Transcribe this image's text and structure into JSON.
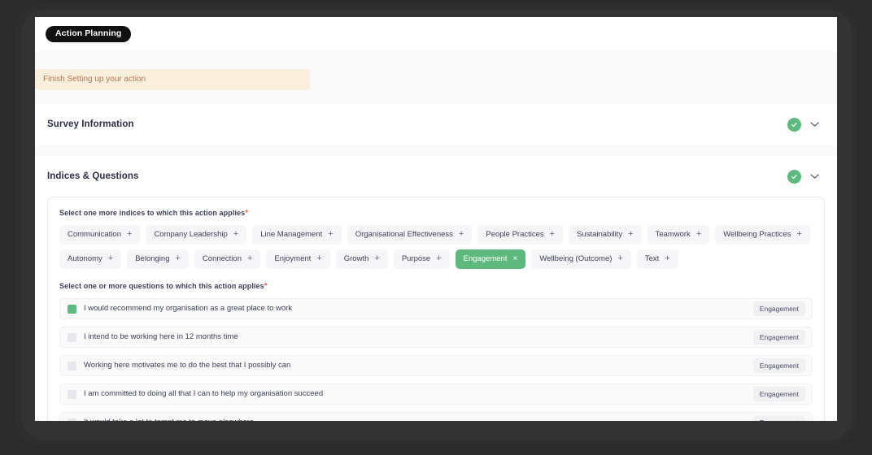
{
  "breadcrumb": {
    "label": "Action Planning"
  },
  "notice": {
    "text": "Finish Setting up your action"
  },
  "sections": [
    {
      "title": "Survey Information",
      "status_icon": "check-circle-icon",
      "toggle_icon": "chevron-down-icon"
    },
    {
      "title": "Indices & Questions",
      "status_icon": "check-circle-icon",
      "toggle_icon": "chevron-down-icon"
    }
  ],
  "indices": {
    "label": "Select one more indices to which this action applies",
    "required_marker": "*",
    "add_symbol": "+",
    "remove_symbol": "×",
    "chips": [
      {
        "label": "Communication",
        "selected": false
      },
      {
        "label": "Company Leadership",
        "selected": false
      },
      {
        "label": "Line Management",
        "selected": false
      },
      {
        "label": "Organisational Effectiveness",
        "selected": false
      },
      {
        "label": "People Practices",
        "selected": false
      },
      {
        "label": "Sustainability",
        "selected": false
      },
      {
        "label": "Teamwork",
        "selected": false
      },
      {
        "label": "Wellbeing Practices",
        "selected": false
      },
      {
        "label": "Autonomy",
        "selected": false
      },
      {
        "label": "Belonging",
        "selected": false
      },
      {
        "label": "Connection",
        "selected": false
      },
      {
        "label": "Enjoyment",
        "selected": false
      },
      {
        "label": "Growth",
        "selected": false
      },
      {
        "label": "Purpose",
        "selected": false
      },
      {
        "label": "Engagement",
        "selected": true
      },
      {
        "label": "Wellbeing (Outcome)",
        "selected": false
      },
      {
        "label": "Text",
        "selected": false
      }
    ]
  },
  "questions": {
    "label": "Select one or more questions to which this action applies",
    "required_marker": "*",
    "rows": [
      {
        "text": "I would recommend my organisation as a great place to work",
        "checked": true,
        "badge": "Engagement"
      },
      {
        "text": "I intend to be working here in 12 months time",
        "checked": false,
        "badge": "Engagement"
      },
      {
        "text": "Working here motivates me to do the best that I possibly can",
        "checked": false,
        "badge": "Engagement"
      },
      {
        "text": "I am committed to doing all that I can to help my organisation succeed",
        "checked": false,
        "badge": "Engagement"
      },
      {
        "text": "It would take a lot to tempt me to move elsewhere",
        "checked": false,
        "badge": "Engagement"
      }
    ]
  },
  "colors": {
    "accent_green": "#5fb97f",
    "notice_bg": "#faeedc",
    "notice_text": "#b07a54",
    "pill_bg": "#111111"
  }
}
